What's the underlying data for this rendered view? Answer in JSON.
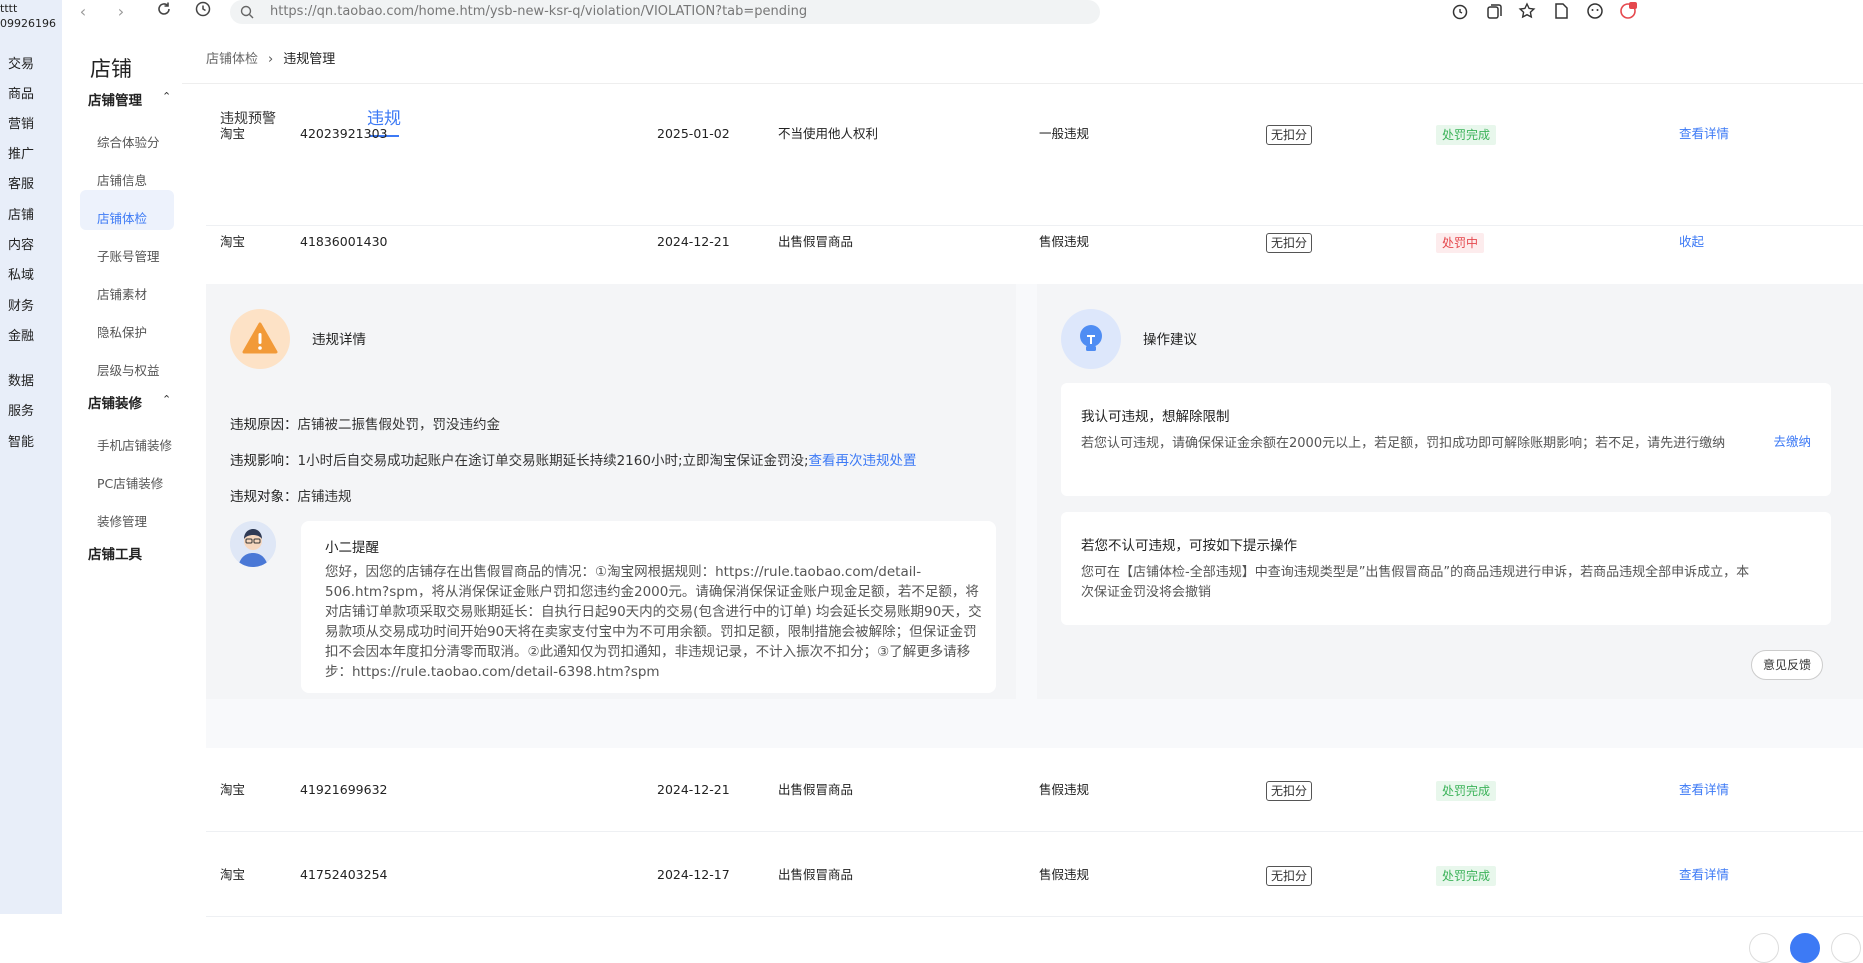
{
  "browser": {
    "url": "https://qn.taobao.com/home.htm/ysb-new-ksr-q/violation/VIOLATION?tab=pending"
  },
  "rail": {
    "user_line1": "tttt",
    "user_line2": "09926196",
    "items": [
      "交易",
      "商品",
      "营销",
      "推广",
      "客服",
      "店铺",
      "内容",
      "私域",
      "财务",
      "金融",
      "数据",
      "服务",
      "智能"
    ]
  },
  "subside": {
    "title": "店铺",
    "group1": "店铺管理",
    "group1_items": [
      "综合体验分",
      "店铺信息",
      "店铺体检",
      "子账号管理",
      "店铺素材",
      "隐私保护",
      "层级与权益"
    ],
    "group2": "店铺装修",
    "group2_items": [
      "手机店铺装修",
      "PC店铺装修",
      "装修管理"
    ],
    "group3": "店铺工具"
  },
  "breadcrumb": {
    "parent": "店铺体检",
    "sep": "›",
    "current": "违规管理"
  },
  "tabs": {
    "warning": "违规预警",
    "violation": "违规"
  },
  "rows": [
    {
      "platform": "淘宝",
      "id": "42023921303",
      "date": "2025-01-02",
      "reason": "不当使用他人权利",
      "type": "一般违规",
      "deduct": "无扣分",
      "status": "处罚完成",
      "action": "查看详情"
    },
    {
      "platform": "淘宝",
      "id": "41836001430",
      "date": "2024-12-21",
      "reason": "出售假冒商品",
      "type": "售假违规",
      "deduct": "无扣分",
      "status": "处罚中",
      "action": "收起"
    },
    {
      "platform": "淘宝",
      "id": "41921699632",
      "date": "2024-12-21",
      "reason": "出售假冒商品",
      "type": "售假违规",
      "deduct": "无扣分",
      "status": "处罚完成",
      "action": "查看详情"
    },
    {
      "platform": "淘宝",
      "id": "41752403254",
      "date": "2024-12-17",
      "reason": "出售假冒商品",
      "type": "售假违规",
      "deduct": "无扣分",
      "status": "处罚完成",
      "action": "查看详情"
    }
  ],
  "detail": {
    "title": "违规详情",
    "reason_label": "违规原因：",
    "reason_value": "店铺被二振售假处罚，罚没违约金",
    "impact_label": "违规影响：",
    "impact_value": "1小时后自交易成功起账户在途订单交易账期延长持续2160小时;立即淘宝保证金罚没;",
    "impact_link": "查看再次违规处置",
    "target_label": "违规对象：",
    "target_value": "店铺违规",
    "tip_title": "小二提醒",
    "tip_body": "您好，因您的店铺存在出售假冒商品的情况：①淘宝网根据规则：https://rule.taobao.com/detail-506.htm?spm，将从消保保证金账户罚扣您违约金2000元。请确保消保保证金账户现金足额，若不足额，将对店铺订单款项采取交易账期延长：自执行日起90天内的交易(包含进行中的订单) 均会延长交易账期90天，交易款项从交易成功时间开始90天将在卖家支付宝中为不可用余额。罚扣足额，限制措施会被解除；但保证金罚扣不会因本年度扣分清零而取消。②此通知仅为罚扣通知，非违规记录，不计入振次不扣分；③了解更多请移步：https://rule.taobao.com/detail-6398.htm?spm"
  },
  "suggest": {
    "title": "操作建议",
    "card1_title": "我认可违规，想解除限制",
    "card1_body": "若您认可违规，请确保保证金余额在2000元以上，若足额，罚扣成功即可解除账期影响；若不足，请先进行缴纳",
    "card1_link": "去缴纳",
    "card2_title": "若您不认可违规，可按如下提示操作",
    "card2_body": "您可在【店铺体检-全部违规】中查询违规类型是”出售假冒商品”的商品违规进行申诉，若商品违规全部申诉成立，本次保证金罚没将会撤销",
    "feedback": "意见反馈"
  },
  "colors": {
    "accent": "#3d7af5",
    "success": "#3cb35a",
    "danger": "#e5484d",
    "warning": "#f29a38"
  }
}
